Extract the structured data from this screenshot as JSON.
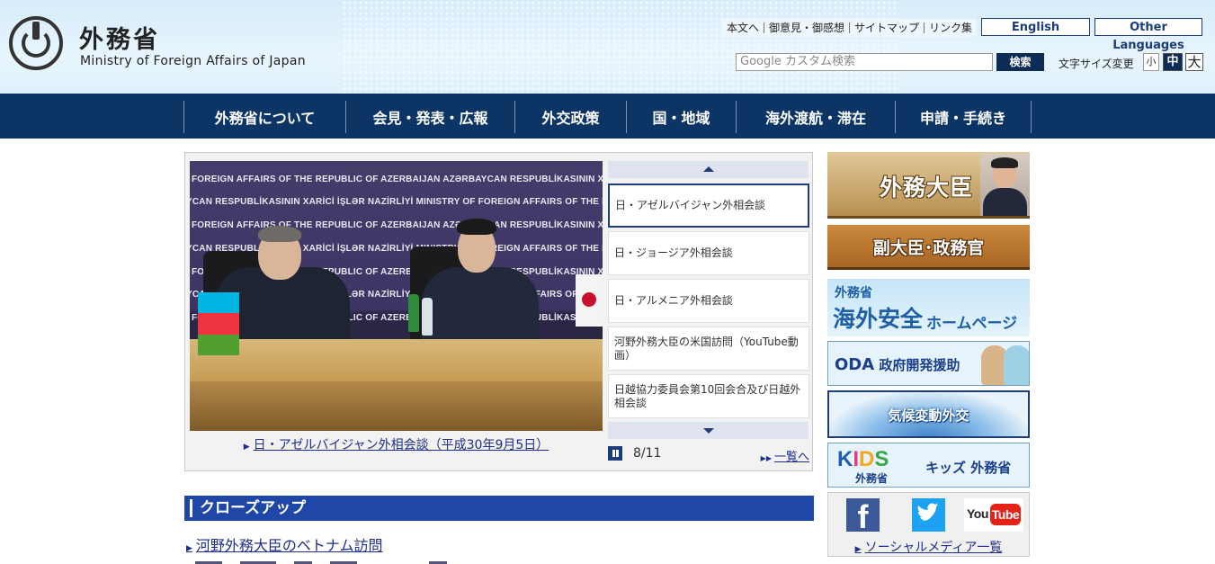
{
  "header": {
    "logo_jp": "外務省",
    "logo_en": "Ministry of Foreign Affairs of Japan",
    "util_links": [
      "本文へ",
      "御意見・御感想",
      "サイトマップ",
      "リンク集"
    ],
    "english_label": "English",
    "other_languages_label": "Other Languages",
    "search_placeholder": "Google カスタム検索",
    "search_button": "検索",
    "font_size_label": "文字サイズ変更",
    "font_sizes": [
      "小",
      "中",
      "大"
    ]
  },
  "nav": {
    "items": [
      "外務省について",
      "会見・発表・広報",
      "外交政策",
      "国・地域",
      "海外渡航・滞在",
      "申請・手続き"
    ]
  },
  "slideshow": {
    "banner_lines": [
      "FOREIGN AFFAIRS OF THE REPUBLIC OF AZERBAIJAN   AZƏRBAYCAN RESPUBLİKASININ XARİCİ İŞLƏR NAZİRLİYİ",
      "YCAN RESPUBLİKASININ XARİCİ İŞLƏR NAZİRLİYİ   MINISTRY OF FOREIGN AFFAIRS OF THE REPUBLIC",
      "FOREIGN AFFAIRS OF THE REPUBLIC OF AZERBAIJAN   AZƏRBAYCAN RESPUBLİKASININ XARİCİ İŞLƏR NAZİRLİYİ",
      "YCAN RESPUBLİKASININ XARİCİ İŞLƏR NAZİRLİYİ   MINISTRY OF FOREIGN AFFAIRS OF THE REPUBLIC",
      "FOREIGN AFFAIRS OF THE REPUBLIC OF AZERBAIJAN   AZƏRBAYCAN RESPUBLİKASININ XARİCİ İŞLƏR NAZİRLİYİ",
      "YCAN RESPUBLİKASININ XARİCİ İŞLƏR NAZİRLİYİ   MINISTRY OF FOREIGN AFFAIRS OF THE REPUBLIC",
      "FOREIGN AFFAIRS OF THE REPUBLIC OF AZERBAIJAN   AZƏRBAYCAN RESPUBLİKASININ XARİCİ İŞLƏR NAZİRLİYİ"
    ],
    "caption": "日・アゼルバイジャン外相会談（平成30年9月5日）",
    "items": [
      "日・アゼルバイジャン外相会談",
      "日・ジョージア外相会談",
      "日・アルメニア外相会談",
      "河野外務大臣の米国訪問（YouTube動画）",
      "日越協力委員会第10回会合及び日越外相会談"
    ],
    "active_index": 0,
    "page_indicator": "8/11",
    "list_link": "一覧へ"
  },
  "closeup": {
    "heading": "クローズアップ",
    "link": "河野外務大臣のベトナム訪問"
  },
  "right_banners": {
    "minister": "外務大臣",
    "vice_minister": "副大臣･政務官",
    "safety_line1": "外務省",
    "safety_line2": "海外安全",
    "safety_line3": "ホームページ",
    "oda_label": "ODA",
    "oda_text": " 政府開発援助",
    "climate": "気候変動外交",
    "kids_logo": "KIDS",
    "kids_sub": "外務省",
    "kids_text": "キッズ 外務省"
  },
  "social": {
    "facebook_glyph": "f",
    "youtube_you": "You",
    "youtube_tube": "Tube",
    "list_link": "ソーシャルメディア一覧"
  },
  "colors": {
    "nav_bg": "#0c3566",
    "accent_blue": "#1e47a8",
    "link": "#1d2f8a",
    "facebook": "#3b5998",
    "twitter": "#1da1f2",
    "youtube": "#e62117"
  },
  "icons": [
    "mofa-logo-icon",
    "pause-icon",
    "arrow-up-icon",
    "arrow-down-icon",
    "facebook-icon",
    "twitter-icon",
    "youtube-icon",
    "triangle-bullet-icon"
  ]
}
